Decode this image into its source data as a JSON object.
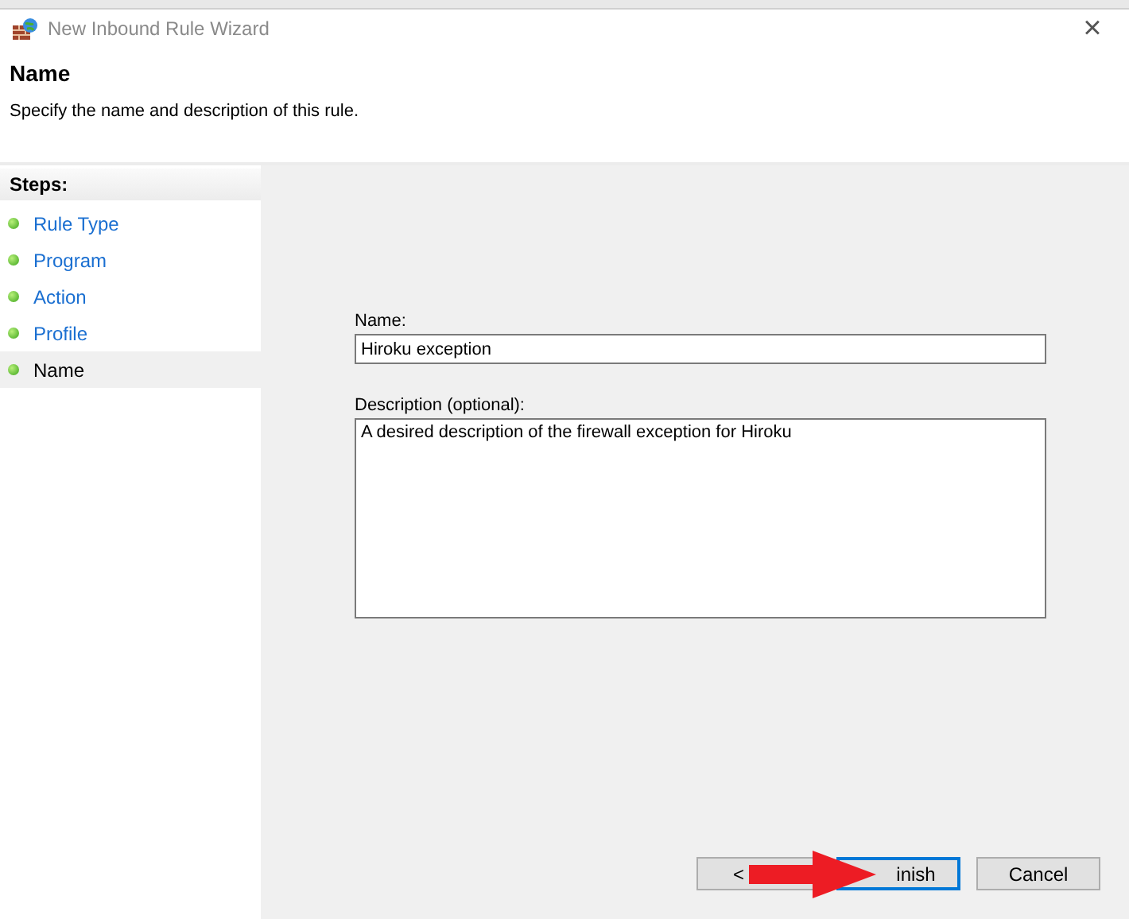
{
  "window": {
    "title": "New Inbound Rule Wizard",
    "close": "×"
  },
  "header": {
    "title": "Name",
    "subtitle": "Specify the name and description of this rule."
  },
  "steps": {
    "heading": "Steps:",
    "items": [
      {
        "label": "Rule Type",
        "selected": false
      },
      {
        "label": "Program",
        "selected": false
      },
      {
        "label": "Action",
        "selected": false
      },
      {
        "label": "Profile",
        "selected": false
      },
      {
        "label": "Name",
        "selected": true
      }
    ]
  },
  "form": {
    "name_label": "Name:",
    "name_value": "Hiroku exception",
    "description_label": "Description (optional):",
    "description_value": "A desired description of the firewall exception for Hiroku"
  },
  "buttons": [
    {
      "label": "<",
      "kind": "back",
      "focused": false
    },
    {
      "label": "inish",
      "kind": "finish",
      "focused": true
    },
    {
      "label": "Cancel",
      "kind": "cancel",
      "focused": false
    }
  ]
}
